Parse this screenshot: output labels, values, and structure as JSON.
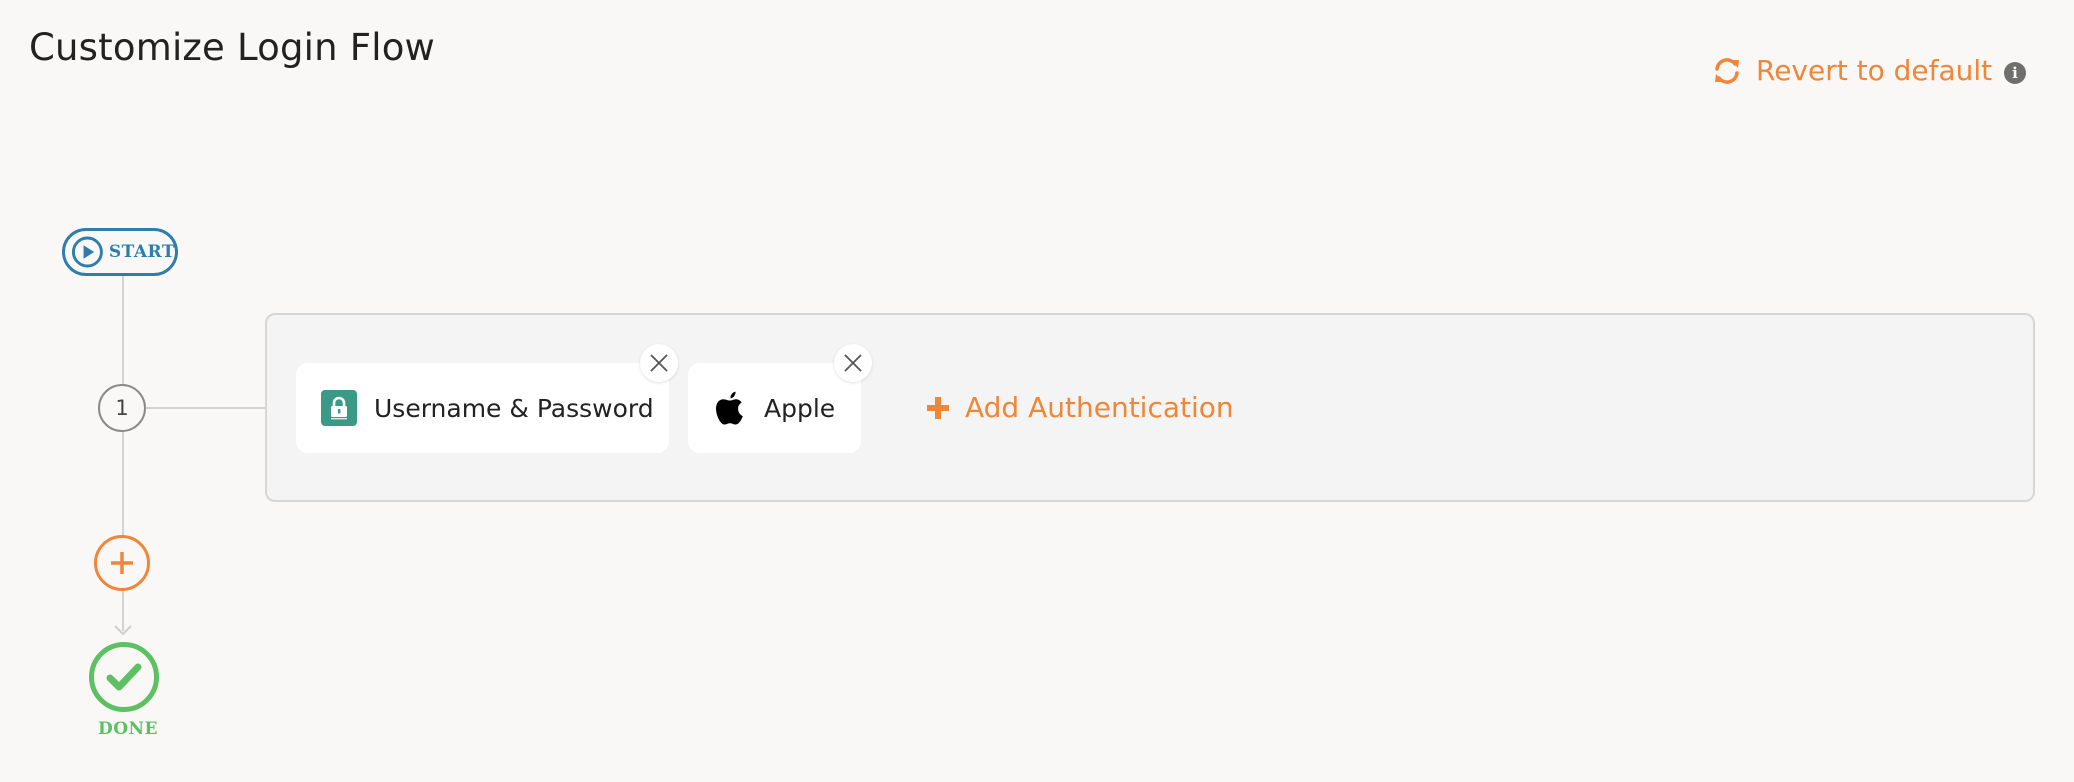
{
  "page": {
    "title": "Customize Login Flow"
  },
  "header": {
    "revert_label": "Revert to default",
    "revert_icon": "refresh-icon",
    "info_icon": "info-icon",
    "info_glyph": "i"
  },
  "flow": {
    "start_label": "START",
    "steps": [
      {
        "number": "1",
        "methods": [
          {
            "label": "Username & Password",
            "icon": "lock-icon"
          },
          {
            "label": "Apple",
            "icon": "apple-icon"
          }
        ],
        "add_label": "Add Authentication"
      }
    ],
    "done_label": "DONE"
  },
  "colors": {
    "accent": "#ef8638",
    "start": "#2e7daa",
    "done": "#5dc063",
    "lock_tile": "#3b9a87"
  }
}
